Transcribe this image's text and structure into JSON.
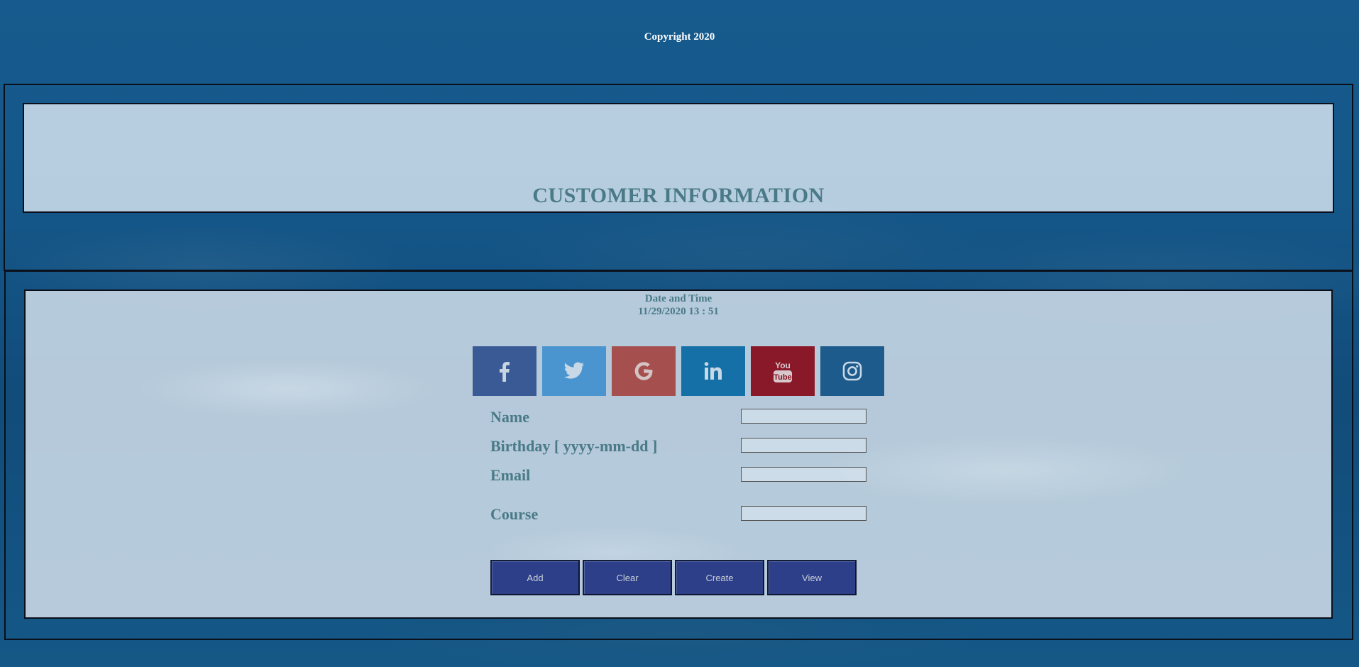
{
  "footer": {
    "copyright": "Copyright 2020"
  },
  "header": {
    "title": "CUSTOMER INFORMATION"
  },
  "datetime": {
    "label": "Date and Time",
    "value": "11/29/2020 13 : 51"
  },
  "social": [
    {
      "name": "facebook",
      "icon": "facebook-icon",
      "color": "#3a5a96"
    },
    {
      "name": "twitter",
      "icon": "twitter-icon",
      "color": "#4a95cf"
    },
    {
      "name": "google",
      "icon": "google-icon",
      "color": "#a5504e"
    },
    {
      "name": "linkedin",
      "icon": "linkedin-icon",
      "color": "#1470a6"
    },
    {
      "name": "youtube",
      "icon": "youtube-icon",
      "color": "#891828"
    },
    {
      "name": "instagram",
      "icon": "instagram-icon",
      "color": "#1c5b8c"
    }
  ],
  "form": {
    "fields": [
      {
        "label": "Name",
        "value": ""
      },
      {
        "label": "Birthday [ yyyy-mm-dd ]",
        "value": ""
      },
      {
        "label": "Email",
        "value": ""
      },
      {
        "label": "Course",
        "value": ""
      }
    ]
  },
  "buttons": {
    "add": "Add",
    "clear": "Clear",
    "create": "Create",
    "view": "View"
  },
  "colors": {
    "accent_text": "#4a7a87",
    "button_bg": "#2e3f8a",
    "page_bg": "#175a8d"
  }
}
